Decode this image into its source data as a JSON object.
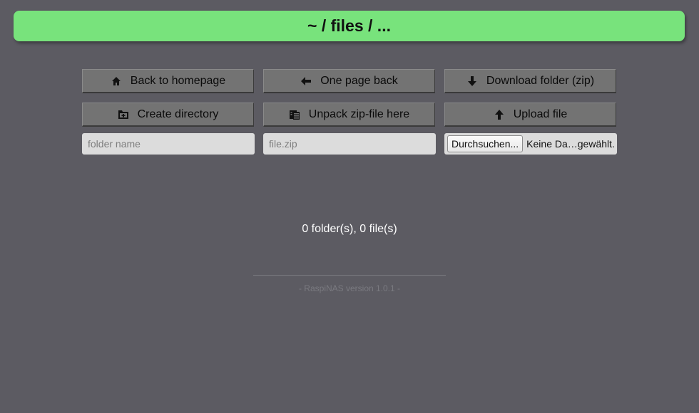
{
  "header": {
    "title": "~ / files / ..."
  },
  "buttons": {
    "back_home": "Back to homepage",
    "one_page_back": "One page back",
    "download_zip": "Download folder (zip)",
    "create_dir": "Create directory",
    "unpack_zip": "Unpack zip-file here",
    "upload_file": "Upload file"
  },
  "inputs": {
    "folder_name_placeholder": "folder name",
    "zip_placeholder": "file.zip",
    "file_browse_label": "Durchsuchen...",
    "file_status": "Keine Da…gewählt."
  },
  "summary": {
    "counts": "0 folder(s), 0 file(s)"
  },
  "footer": {
    "version": "- RaspiNAS version 1.0.1 -"
  },
  "colors": {
    "background": "#5c5b62",
    "header": "#78e37c",
    "button": "#737373",
    "input": "#dcdcdc"
  }
}
